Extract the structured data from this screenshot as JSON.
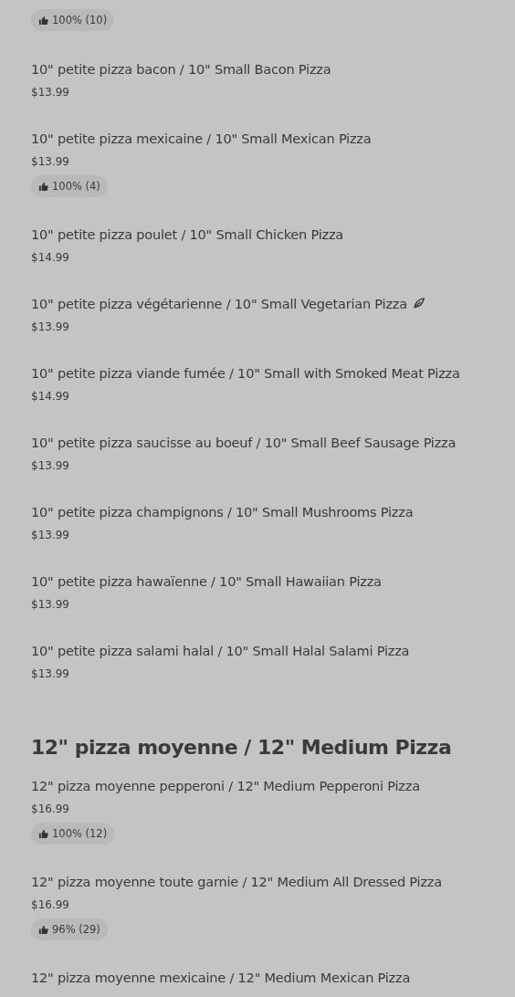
{
  "leading_rating": {
    "label": "100% (10)"
  },
  "sections": [
    {
      "items": [
        {
          "name": "10\" petite pizza bacon / 10\" Small Bacon Pizza",
          "price": "$13.99",
          "vegetarian": false
        },
        {
          "name": "10\" petite pizza mexicaine / 10\" Small Mexican Pizza",
          "price": "$13.99",
          "rating": "100% (4)",
          "vegetarian": false
        },
        {
          "name": "10\" petite pizza poulet / 10\" Small Chicken Pizza",
          "price": "$14.99",
          "vegetarian": false
        },
        {
          "name": "10\" petite pizza végétarienne / 10\" Small Vegetarian Pizza",
          "price": "$13.99",
          "vegetarian": true
        },
        {
          "name": "10\" petite pizza viande fumée / 10\" Small with Smoked Meat Pizza",
          "price": "$14.99",
          "vegetarian": false
        },
        {
          "name": "10\" petite pizza saucisse au boeuf / 10\" Small Beef Sausage Pizza",
          "price": "$13.99",
          "vegetarian": false
        },
        {
          "name": "10\" petite pizza champignons / 10\" Small Mushrooms Pizza",
          "price": "$13.99",
          "vegetarian": false
        },
        {
          "name": "10\" petite pizza hawaïenne / 10\" Small Hawaiian Pizza",
          "price": "$13.99",
          "vegetarian": false
        },
        {
          "name": "10\" petite pizza salami halal / 10\" Small Halal Salami Pizza",
          "price": "$13.99",
          "vegetarian": false
        }
      ]
    },
    {
      "title": "12\" pizza moyenne / 12\" Medium Pizza",
      "items": [
        {
          "name": "12\" pizza moyenne pepperoni / 12\" Medium Pepperoni Pizza",
          "price": "$16.99",
          "rating": "100% (12)",
          "vegetarian": false
        },
        {
          "name": "12\" pizza moyenne toute garnie / 12\" Medium All Dressed Pizza",
          "price": "$16.99",
          "rating": "96% (29)",
          "vegetarian": false
        },
        {
          "name": "12\" pizza moyenne mexicaine / 12\" Medium Mexican Pizza",
          "vegetarian": false
        }
      ]
    }
  ]
}
